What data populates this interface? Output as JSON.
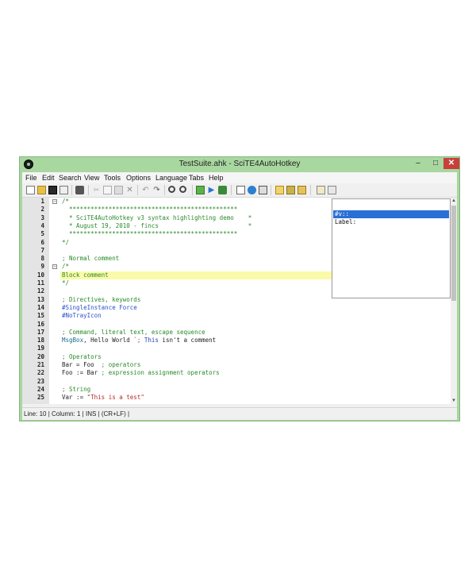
{
  "window": {
    "title": "TestSuite.ahk - SciTE4AutoHotkey",
    "controls": {
      "minimize": "–",
      "maximize": "□",
      "close": "✕"
    }
  },
  "menu": [
    "File",
    "Edit",
    "Search",
    "View",
    "Tools",
    "Options",
    "Language",
    "Tabs",
    "Help"
  ],
  "toolbar_icons": [
    "new-file-icon",
    "open-folder-icon",
    "save-icon",
    "print-preview-icon",
    "print-icon",
    "cut-icon",
    "copy-icon",
    "paste-icon",
    "delete-icon",
    "undo-icon",
    "redo-icon",
    "find-icon",
    "replace-icon",
    "compile-icon",
    "run-icon",
    "debug-icon",
    "window-spy-icon",
    "help-icon",
    "settings-icon",
    "bookmark-icon",
    "page-icon",
    "tab-icon",
    "extra-icon"
  ],
  "editor": {
    "lines": [
      {
        "n": "1",
        "parts": [
          [
            "c-comment",
            "/*"
          ]
        ],
        "fold": "−"
      },
      {
        "n": "2",
        "parts": [
          [
            "c-comment",
            "  ***********************************************"
          ]
        ]
      },
      {
        "n": "3",
        "parts": [
          [
            "c-comment",
            "  * SciTE4AutoHotkey v3 syntax highlighting demo    *"
          ]
        ]
      },
      {
        "n": "4",
        "parts": [
          [
            "c-comment",
            "  * August 19, 2010 - fincs                         *"
          ]
        ]
      },
      {
        "n": "5",
        "parts": [
          [
            "c-comment",
            "  ***********************************************"
          ]
        ]
      },
      {
        "n": "6",
        "parts": [
          [
            "c-comment",
            "*/"
          ]
        ]
      },
      {
        "n": "7",
        "parts": []
      },
      {
        "n": "8",
        "parts": [
          [
            "c-comment",
            "; Normal comment"
          ]
        ]
      },
      {
        "n": "9",
        "parts": [
          [
            "c-comment",
            "/*"
          ]
        ],
        "fold": "−"
      },
      {
        "n": "10",
        "parts": [
          [
            "c-comment",
            "Block comment"
          ]
        ],
        "hl": true
      },
      {
        "n": "11",
        "parts": [
          [
            "c-comment",
            "*/"
          ]
        ]
      },
      {
        "n": "12",
        "parts": []
      },
      {
        "n": "13",
        "parts": [
          [
            "c-comment",
            "; Directives, keywords"
          ]
        ]
      },
      {
        "n": "14",
        "parts": [
          [
            "c-directive",
            "#SingleInstance Force"
          ]
        ]
      },
      {
        "n": "15",
        "parts": [
          [
            "c-directive",
            "#NoTrayIcon"
          ]
        ]
      },
      {
        "n": "16",
        "parts": []
      },
      {
        "n": "17",
        "parts": [
          [
            "c-comment",
            "; Command, literal text, escape sequence"
          ]
        ]
      },
      {
        "n": "18",
        "parts": [
          [
            "c-cmd",
            "MsgBox"
          ],
          [
            "c-text",
            ", Hello World "
          ],
          [
            "c-esc",
            "`;"
          ],
          [
            "c-text",
            " "
          ],
          [
            "c-kw",
            "This"
          ],
          [
            "c-text",
            " isn't a comment"
          ]
        ]
      },
      {
        "n": "19",
        "parts": []
      },
      {
        "n": "20",
        "parts": [
          [
            "c-comment",
            "; Operators"
          ]
        ]
      },
      {
        "n": "21",
        "parts": [
          [
            "c-text",
            "Bar = Foo  "
          ],
          [
            "c-comment",
            "; operators"
          ]
        ]
      },
      {
        "n": "22",
        "parts": [
          [
            "c-text",
            "Foo := Bar "
          ],
          [
            "c-comment",
            "; expression assignment operators"
          ]
        ]
      },
      {
        "n": "23",
        "parts": []
      },
      {
        "n": "24",
        "parts": [
          [
            "c-comment",
            "; String"
          ]
        ]
      },
      {
        "n": "25",
        "parts": [
          [
            "c-text",
            "Var := "
          ],
          [
            "c-string",
            "\"This is a test\""
          ]
        ]
      }
    ]
  },
  "autocomplete": {
    "items": [
      {
        "label": "#v::",
        "selected": true
      },
      {
        "label": "Label:",
        "selected": false
      }
    ]
  },
  "status": {
    "text": "Line: 10 | Column: 1 | INS | (CR+LF) |"
  },
  "colors": {
    "titlebar": "#a9d7a0",
    "line_highlight": "#fbfaa9",
    "comment": "#2a8a2a",
    "directive": "#2c52c9",
    "selection": "#2a6fd6"
  }
}
